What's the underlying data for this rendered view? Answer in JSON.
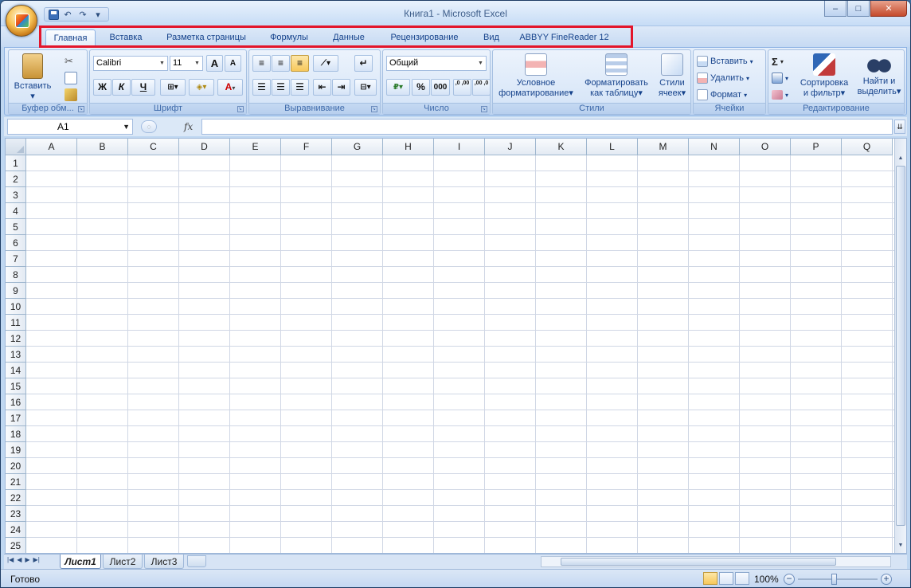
{
  "window": {
    "title": "Книга1 - Microsoft Excel",
    "controls": {
      "minimize": "–",
      "maximize": "□",
      "close": "✕"
    }
  },
  "quick_access": {
    "undo": "↶",
    "redo": "↷",
    "customize": "▾"
  },
  "tabs": [
    {
      "label": "Главная",
      "active": true
    },
    {
      "label": "Вставка"
    },
    {
      "label": "Разметка страницы"
    },
    {
      "label": "Формулы"
    },
    {
      "label": "Данные"
    },
    {
      "label": "Рецензирование"
    },
    {
      "label": "Вид"
    },
    {
      "label": "ABBYY FineReader 12"
    }
  ],
  "highlight_color": "#e3152b",
  "ribbon": {
    "clipboard": {
      "label": "Буфер обм...",
      "paste": "Вставить"
    },
    "font": {
      "label": "Шрифт",
      "font_name": "Calibri",
      "font_size": "11",
      "grow": "A",
      "shrink": "A",
      "bold": "Ж",
      "italic": "К",
      "underline": "Ч",
      "font_color": "A"
    },
    "alignment": {
      "label": "Выравнивание"
    },
    "number": {
      "label": "Число",
      "format": "Общий",
      "percent": "%",
      "thousands": "000",
      "inc_decimal": ",0 ,00",
      "dec_decimal": ",00 ,0"
    },
    "styles": {
      "label": "Стили",
      "conditional": [
        "Условное",
        "форматирование"
      ],
      "format_table": [
        "Форматировать",
        "как таблицу"
      ],
      "cell_styles": [
        "Стили",
        "ячеек"
      ]
    },
    "cells": {
      "label": "Ячейки",
      "insert": "Вставить",
      "delete": "Удалить",
      "format": "Формат"
    },
    "editing": {
      "label": "Редактирование",
      "sum": "Σ",
      "sort_filter": [
        "Сортировка",
        "и фильтр"
      ],
      "find_select": [
        "Найти и",
        "выделить"
      ]
    }
  },
  "formula_bar": {
    "name_box": "A1",
    "fx": "fx",
    "value": ""
  },
  "grid": {
    "columns": [
      "A",
      "B",
      "C",
      "D",
      "E",
      "F",
      "G",
      "H",
      "I",
      "J",
      "K",
      "L",
      "M",
      "N",
      "O",
      "P",
      "Q"
    ],
    "rows": [
      "1",
      "2",
      "3",
      "4",
      "5",
      "6",
      "7",
      "8",
      "9",
      "10",
      "11",
      "12",
      "13",
      "14",
      "15",
      "16",
      "17",
      "18",
      "19",
      "20",
      "21",
      "22",
      "23",
      "24",
      "25"
    ]
  },
  "sheets": [
    {
      "label": "Лист1",
      "active": true
    },
    {
      "label": "Лист2"
    },
    {
      "label": "Лист3"
    }
  ],
  "status": {
    "text": "Готово",
    "zoom": "100%"
  }
}
